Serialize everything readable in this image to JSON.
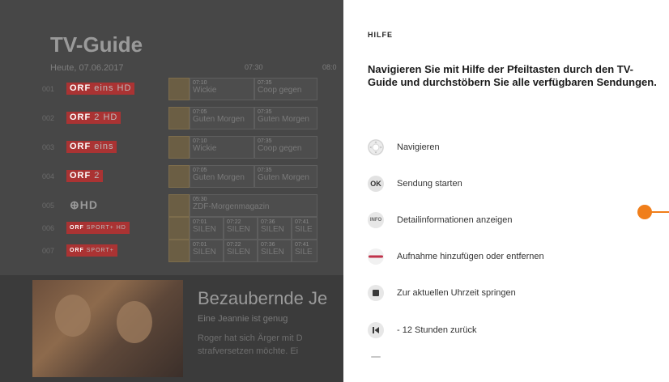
{
  "guide": {
    "title": "TV-Guide",
    "date": "Heute, 07.06.2017",
    "times": [
      "07:30",
      "08:0"
    ],
    "channels": [
      {
        "num": "001",
        "logo": "ORF",
        "sub": "eins HD",
        "programs": [
          {
            "time": "07:10",
            "name": "Wickie"
          },
          {
            "time": "07:35",
            "name": "Coop gegen"
          }
        ]
      },
      {
        "num": "002",
        "logo": "ORF",
        "sub": "2 HD",
        "programs": [
          {
            "time": "07:05",
            "name": "Guten Morgen"
          },
          {
            "time": "07:35",
            "name": "Guten Morgen"
          }
        ]
      },
      {
        "num": "003",
        "logo": "ORF",
        "sub": "eins",
        "programs": [
          {
            "time": "07:10",
            "name": "Wickie"
          },
          {
            "time": "07:35",
            "name": "Coop gegen"
          }
        ]
      },
      {
        "num": "004",
        "logo": "ORF",
        "sub": "2",
        "programs": [
          {
            "time": "07:05",
            "name": "Guten Morgen"
          },
          {
            "time": "07:35",
            "name": "Guten Morgen"
          }
        ]
      },
      {
        "num": "005",
        "logo": "⊕HD",
        "sub": "",
        "programs": [
          {
            "time": "05:30",
            "name": "ZDF-Morgenmagazin"
          }
        ]
      },
      {
        "num": "006",
        "logo": "ORF",
        "sub": "SPORT+ HD",
        "programs": [
          {
            "time": "07:01",
            "name": "SILEN"
          },
          {
            "time": "07:22",
            "name": "SILEN"
          },
          {
            "time": "07:36",
            "name": "SILEN"
          },
          {
            "time": "07:41",
            "name": "SILE"
          }
        ]
      },
      {
        "num": "007",
        "logo": "ORF",
        "sub": "SPORT+",
        "programs": [
          {
            "time": "07:01",
            "name": "SILEN"
          },
          {
            "time": "07:22",
            "name": "SILEN"
          },
          {
            "time": "07:36",
            "name": "SILEN"
          },
          {
            "time": "07:41",
            "name": "SILE"
          }
        ]
      }
    ],
    "featured": {
      "title": "Bezaubernde Je",
      "subtitle": "Eine Jeannie ist genug",
      "description_lines": [
        "Roger hat sich Ärger mit D",
        "strafversetzen möchte. Ei"
      ]
    }
  },
  "help": {
    "heading": "HILFE",
    "intro": "Navigieren Sie mit Hilfe der Pfeiltasten durch den TV-Guide und durchstöbern Sie alle verfügbaren Sendungen.",
    "items": [
      {
        "icon": "dpad-icon",
        "label": "Navigieren"
      },
      {
        "icon": "ok-icon",
        "icon_text": "OK",
        "label": "Sendung starten"
      },
      {
        "icon": "info-icon",
        "icon_text": "INFO",
        "label": "Detailinformationen anzeigen"
      },
      {
        "icon": "red-record-icon",
        "label": "Aufnahme hinzufügen oder entfernen"
      },
      {
        "icon": "stop-square-icon",
        "label": "Zur aktuellen Uhrzeit springen"
      },
      {
        "icon": "skip-back-icon",
        "label": "- 12 Stunden zurück"
      }
    ]
  },
  "colors": {
    "accent": "#f07e1a",
    "record_red": "#c0334a",
    "panel_bg": "#ffffff",
    "guide_bg": "#474747"
  }
}
